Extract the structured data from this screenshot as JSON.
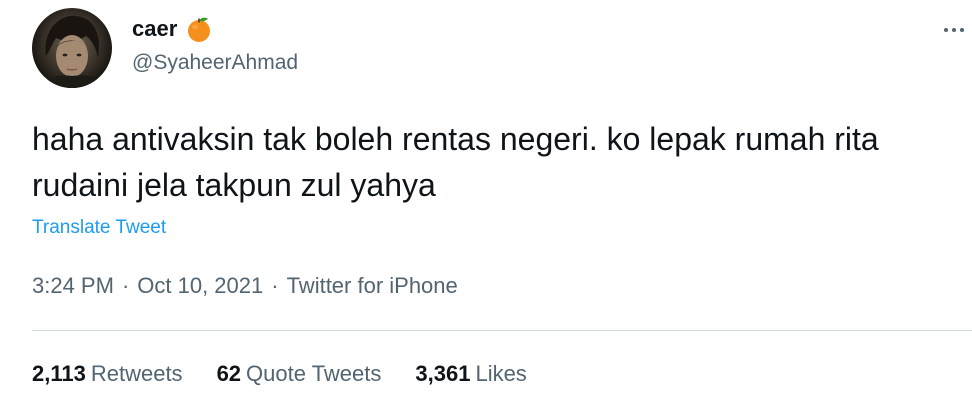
{
  "user": {
    "display_name": "caer",
    "handle": "@SyaheerAhmad",
    "badge_icon": "orange-icon"
  },
  "tweet": {
    "text": "haha antivaksin tak boleh rentas negeri. ko lepak rumah rita rudaini jela takpun zul yahya",
    "translate_label": "Translate Tweet"
  },
  "meta": {
    "time": "3:24 PM",
    "date": "Oct 10, 2021",
    "source": "Twitter for iPhone",
    "separator": "·"
  },
  "stats": {
    "retweets_count": "2,113",
    "retweets_label": "Retweets",
    "quote_count": "62",
    "quote_label": "Quote Tweets",
    "likes_count": "3,361",
    "likes_label": "Likes"
  },
  "colors": {
    "link": "#1d9bf0",
    "secondary_text": "#536471",
    "primary_text": "#0f1419",
    "badge_orange": "#f5901e"
  }
}
